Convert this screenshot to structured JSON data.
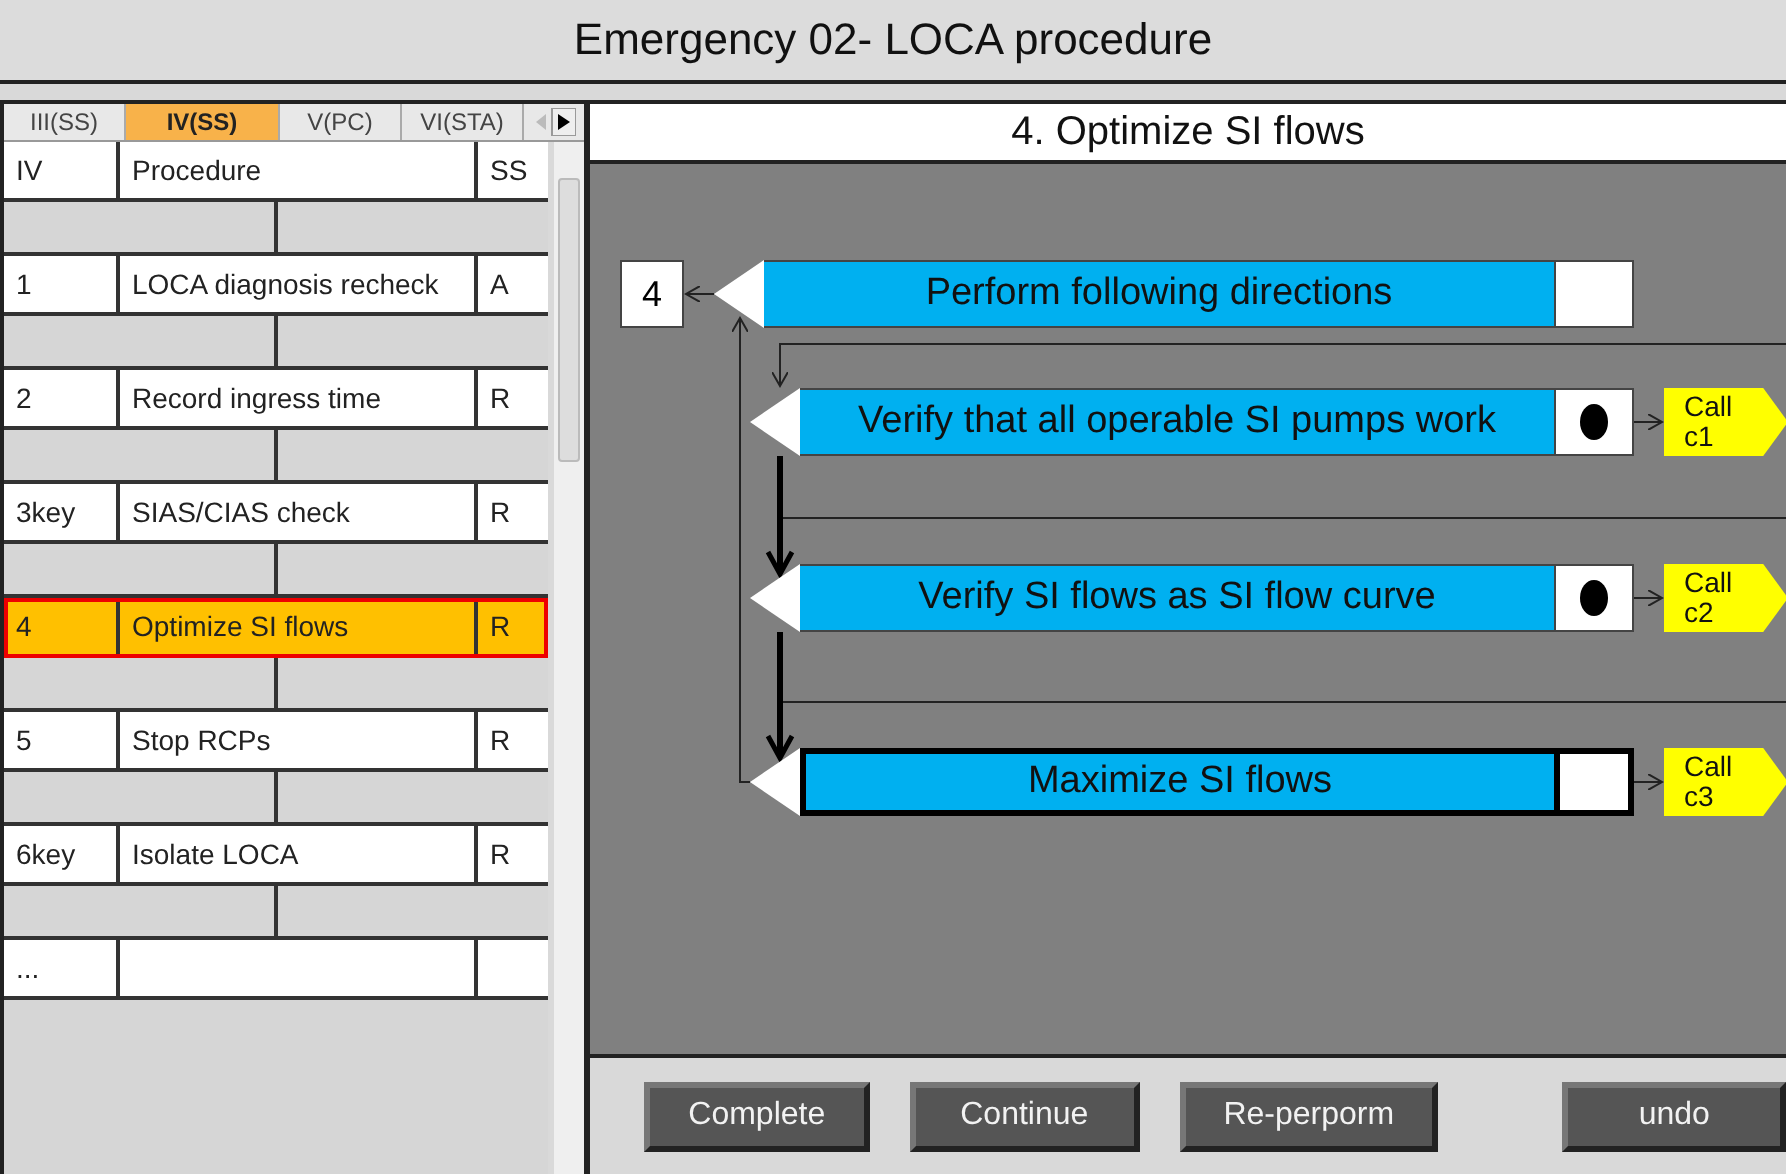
{
  "window": {
    "title": "Emergency 02- LOCA procedure"
  },
  "tabs": [
    {
      "label": "III(SS)",
      "selected": false
    },
    {
      "label": "IV(SS)",
      "selected": true
    },
    {
      "label": "V(PC)",
      "selected": false
    },
    {
      "label": "VI(STA)",
      "selected": false
    }
  ],
  "procedure_table": {
    "columns": [
      "IV",
      "Procedure",
      "SS"
    ],
    "rows": [
      {
        "number": "1",
        "procedure": "LOCA diagnosis recheck",
        "ss": "A",
        "selected": false
      },
      {
        "number": "2",
        "procedure": "Record ingress time",
        "ss": "R",
        "selected": false
      },
      {
        "number": "3key",
        "procedure": "SIAS/CIAS check",
        "ss": "R",
        "selected": false
      },
      {
        "number": "4",
        "procedure": "Optimize SI flows",
        "ss": "R",
        "selected": true
      },
      {
        "number": "5",
        "procedure": "Stop RCPs",
        "ss": "R",
        "selected": false
      },
      {
        "number": "6key",
        "procedure": "Isolate LOCA",
        "ss": "R",
        "selected": false
      },
      {
        "number": "...",
        "selected": false
      }
    ]
  },
  "step": {
    "title": "4. Optimize SI flows",
    "number": "4",
    "items": [
      {
        "kind": "header",
        "label": "Perform following directions",
        "done": false,
        "current": false
      },
      {
        "kind": "check",
        "label": "Verify that all operable SI pumps work",
        "done": true,
        "current": false,
        "call": "Call c1"
      },
      {
        "kind": "check",
        "label": "Verify SI flows as SI flow curve",
        "done": true,
        "current": false,
        "call": "Call c2"
      },
      {
        "kind": "action",
        "label": "Maximize SI flows",
        "done": false,
        "current": true,
        "call": "Call c3"
      }
    ]
  },
  "buttons": [
    "Complete",
    "Continue",
    "Re-perporm",
    "undo"
  ]
}
